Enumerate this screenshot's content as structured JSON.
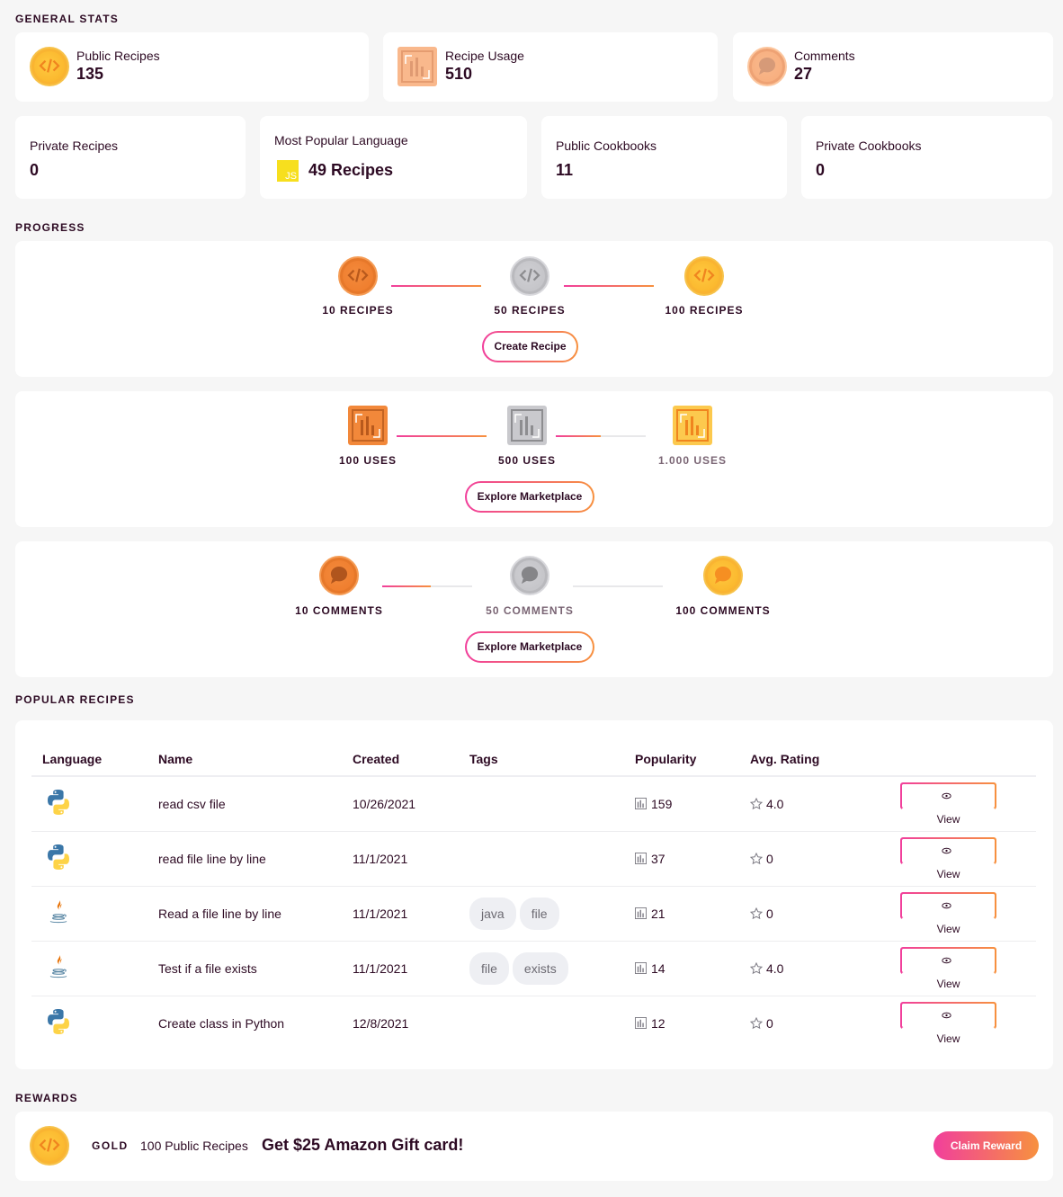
{
  "general_stats": {
    "title": "GENERAL STATS",
    "top": [
      {
        "label": "Public Recipes",
        "value": "135",
        "icon": "code-coin-icon"
      },
      {
        "label": "Recipe Usage",
        "value": "510",
        "icon": "bar-chart-icon"
      },
      {
        "label": "Comments",
        "value": "27",
        "icon": "comment-coin-icon"
      }
    ],
    "bottom": [
      {
        "label": "Private Recipes",
        "value": "0"
      },
      {
        "label": "Most Popular Language",
        "value": "49 Recipes",
        "badge": "JS"
      },
      {
        "label": "Public Cookbooks",
        "value": "11"
      },
      {
        "label": "Private Cookbooks",
        "value": "0"
      }
    ]
  },
  "progress": {
    "title": "PROGRESS",
    "tracks": [
      {
        "milestones": [
          "10 RECIPES",
          "50 RECIPES",
          "100 RECIPES"
        ],
        "milestone_dimmed": [
          false,
          false,
          false
        ],
        "segment_progress": [
          1.0,
          1.0
        ],
        "button": "Create Recipe"
      },
      {
        "milestones": [
          "100 USES",
          "500 USES",
          "1.000 USES"
        ],
        "milestone_dimmed": [
          false,
          false,
          true
        ],
        "segment_progress": [
          1.0,
          0.5
        ],
        "button": "Explore Marketplace"
      },
      {
        "milestones": [
          "10 COMMENTS",
          "50 COMMENTS",
          "100 COMMENTS"
        ],
        "milestone_dimmed": [
          false,
          true,
          false
        ],
        "segment_progress": [
          0.54,
          0.0
        ],
        "button": "Explore Marketplace"
      }
    ]
  },
  "popular_recipes": {
    "title": "POPULAR RECIPES",
    "columns": [
      "Language",
      "Name",
      "Created",
      "Tags",
      "Popularity",
      "Avg. Rating",
      ""
    ],
    "rows": [
      {
        "language": "python",
        "name": "read csv file",
        "created": "10/26/2021",
        "tags": [],
        "popularity": "159",
        "rating": "4.0",
        "action": "View"
      },
      {
        "language": "python",
        "name": "read file line by line",
        "created": "11/1/2021",
        "tags": [],
        "popularity": "37",
        "rating": "0",
        "action": "View"
      },
      {
        "language": "java",
        "name": "Read a file line by line",
        "created": "11/1/2021",
        "tags": [
          "java",
          "file"
        ],
        "popularity": "21",
        "rating": "0",
        "action": "View"
      },
      {
        "language": "java",
        "name": "Test if a file exists",
        "created": "11/1/2021",
        "tags": [
          "file",
          "exists"
        ],
        "popularity": "14",
        "rating": "4.0",
        "action": "View"
      },
      {
        "language": "python",
        "name": "Create class in Python",
        "created": "12/8/2021",
        "tags": [],
        "popularity": "12",
        "rating": "0",
        "action": "View"
      }
    ]
  },
  "rewards": {
    "title": "REWARDS",
    "tier": "GOLD",
    "requirement": "100 Public Recipes",
    "prize": "Get $25 Amazon Gift card!",
    "button": "Claim Reward"
  },
  "colors": {
    "text": "#2d0a23",
    "gradient_start": "#f13f9c",
    "gradient_end": "#f7913f",
    "gold": "#fbb92f",
    "bronze": "#ef7d2d",
    "silver": "#c4c4c8",
    "js_yellow": "#f7df1e"
  }
}
